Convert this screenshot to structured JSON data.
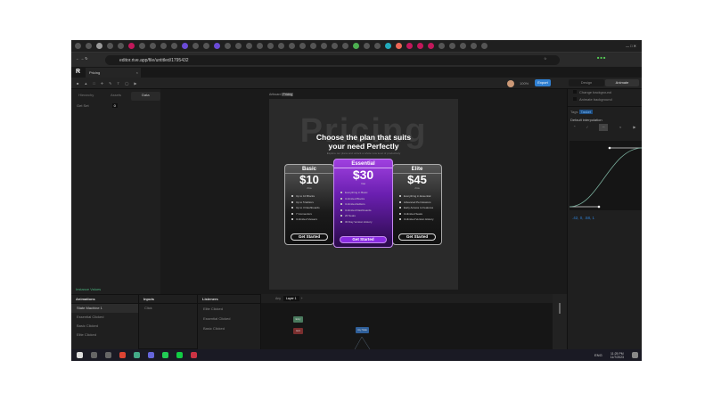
{
  "browser": {
    "url": "editor.rive.app/file/untitled/1795432",
    "tab_title": "Pricing"
  },
  "toolbar": {
    "zoom": "100%",
    "export_label": "Export",
    "mode_tabs": [
      "Design",
      "Animate"
    ]
  },
  "left_panel": {
    "tabs": [
      "Hierarchy",
      "Assets",
      "Data"
    ],
    "rows": [
      {
        "label": "Get Set",
        "value": "0"
      }
    ],
    "footer": "Instance Values"
  },
  "artboard": {
    "label": "Artboard",
    "badge": "Pricing"
  },
  "pricing": {
    "watermark": "Pricing",
    "headline_1": "Choose the plan that suits",
    "headline_2": "your need Perfectly",
    "subtext": "Explore our plans and unlock a whole new level of productivity",
    "plans": [
      {
        "name": "Basic",
        "price": "$10",
        "period": "/mo",
        "features": [
          "Up to 10 Blocks",
          "Up to 5 Editors",
          "Up to 3 Dashboards",
          "7 Connectors",
          "Unlimited Viewers"
        ],
        "cta": "Get Started"
      },
      {
        "name": "Essential",
        "price": "$30",
        "period": "/mo",
        "features": [
          "Everything in Basic",
          "Unlimited Blocks",
          "Unlimited Editors",
          "Unlimited Dashboards",
          "20 Seats",
          "30 Day Version History"
        ],
        "cta": "Get Started"
      },
      {
        "name": "Elite",
        "price": "$45",
        "period": "/mo",
        "features": [
          "Everything in Essential",
          "Advanced Permissions",
          "Early Access to Features",
          "Unlimited Seats",
          "Unlimited Version History"
        ],
        "cta": "Get Started"
      }
    ]
  },
  "right_panel": {
    "checkboxes": [
      "Change background",
      "Animate background"
    ],
    "tags_label": "Tags",
    "tag": "Tasket",
    "interp_label": "Default interpolation",
    "curve_value": ".42, 0, .58, 1"
  },
  "bottom": {
    "animations_title": "Animations",
    "animations": [
      "State Machine 1",
      "Essential Clicked",
      "Basic Clicked",
      "Elite Clicked"
    ],
    "inputs_title": "Inputs",
    "inputs": [
      "Click"
    ],
    "listeners_title": "Listeners",
    "listeners": [
      "Elite Clicked",
      "Essential Clicked",
      "Basic Clicked"
    ],
    "graph_tabs": [
      "Any",
      "Layer 1"
    ],
    "nodes": [
      "Entry",
      "Exit",
      "Any State"
    ]
  },
  "taskbar": {
    "lang": "ENG",
    "time": "11:25 PM",
    "date": "11/7/2023"
  },
  "colors": {
    "accent": "#2f7fd1",
    "purple": "#8a2be2",
    "green": "#4caf7d"
  }
}
